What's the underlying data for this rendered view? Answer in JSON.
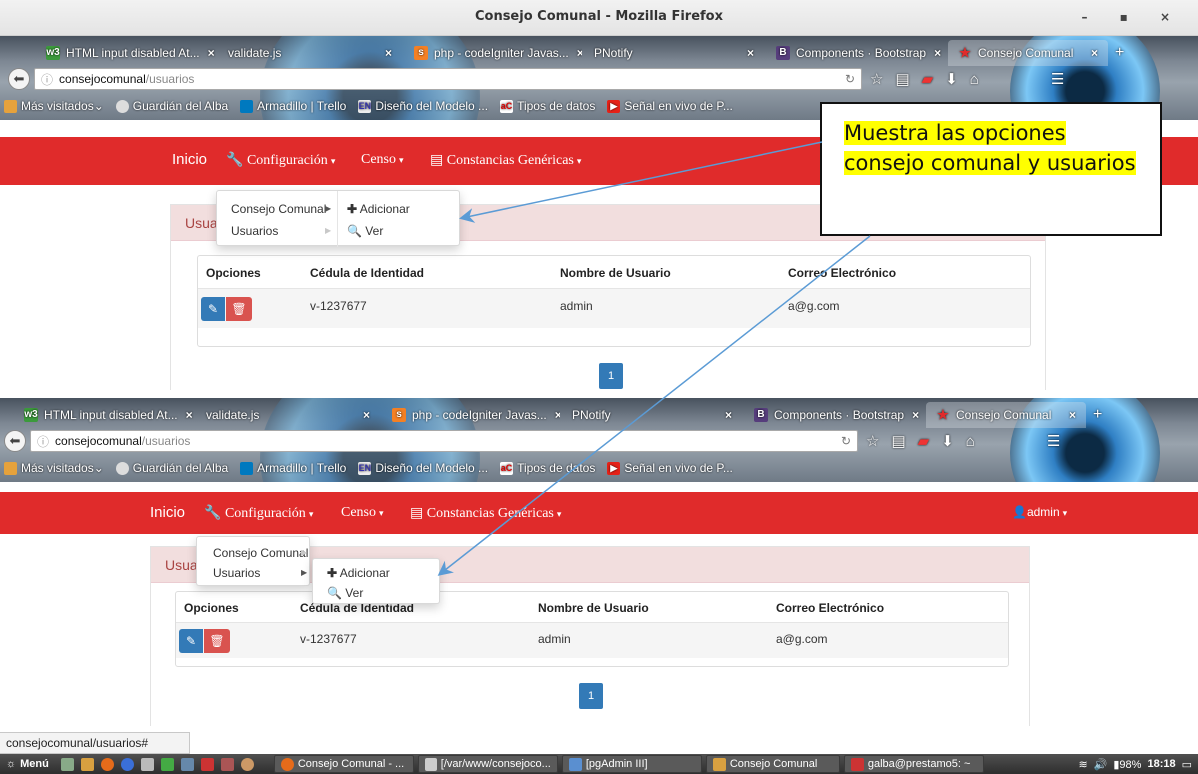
{
  "window": {
    "title": "Consejo Comunal - Mozilla Firefox",
    "controls": [
      "-",
      "▪",
      "×"
    ]
  },
  "tabs": [
    {
      "label": "HTML input disabled At...",
      "favicon": "w3-icon"
    },
    {
      "label": "validate.js",
      "favicon": "none"
    },
    {
      "label": "php - codeIgniter Javas...",
      "favicon": "stackoverflow-icon"
    },
    {
      "label": "PNotify",
      "favicon": "none"
    },
    {
      "label": "Components · Bootstrap",
      "favicon": "bootstrap-icon"
    },
    {
      "label": "Consejo Comunal",
      "favicon": "star-icon",
      "active": true
    }
  ],
  "url": {
    "host": "consejocomunal",
    "path": "/usuarios"
  },
  "bookmarks": [
    "Más visitados",
    "Guardián del Alba",
    "Armadillo | Trello",
    "Diseño del Modelo ...",
    "Tipos de datos",
    "Señal en vivo de P..."
  ],
  "nav": {
    "brand": "Inicio",
    "configuracion": "Configuración",
    "censo": "Censo",
    "constancias": "Constancias  Genéricas",
    "user": "admin"
  },
  "dropdown": {
    "consejo": "Consejo Comunal",
    "usuarios": "Usuarios",
    "adicionar": "Adicionar",
    "ver": "Ver"
  },
  "panel": {
    "title_partial": "Usuar"
  },
  "table": {
    "headers": [
      "Opciones",
      "Cédula de Identidad",
      "Nombre de Usuario",
      "Correo Electrónico"
    ],
    "rows": [
      {
        "cedula": "v-1237677",
        "nombre": "admin",
        "correo": "a@g.com"
      }
    ]
  },
  "pagination": {
    "current": "1"
  },
  "callout": {
    "text": "Muestra las opciones consejo comunal y usuarios"
  },
  "statusbar": {
    "text": "consejocomunal/usuarios#"
  },
  "taskbar": {
    "menu": "Menú",
    "windows": [
      "Consejo Comunal - ...",
      "[/var/www/consejoco...",
      "[pgAdmin III]",
      "Consejo Comunal",
      "galba@prestamo5: ~"
    ],
    "battery": "98%",
    "clock": "18:18"
  },
  "colors": {
    "navbar": "#e02b2b",
    "panel_head_bg": "#f2dede",
    "panel_head_text": "#a94442",
    "primary": "#337ab7",
    "danger": "#d9534f",
    "callout_highlight": "#ffff00",
    "arrow": "#5b9bd5"
  }
}
